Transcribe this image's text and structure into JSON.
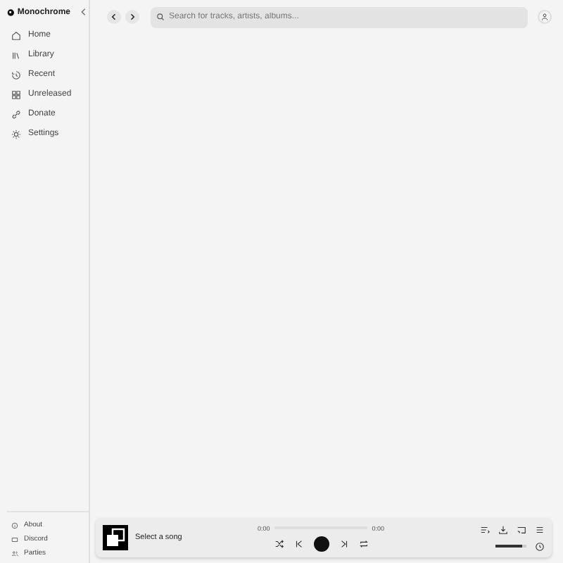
{
  "sidebar": {
    "brand": "Monochrome",
    "items": [
      {
        "label": "Home",
        "selected": false
      },
      {
        "label": "Library",
        "selected": false
      },
      {
        "label": "Recent",
        "selected": false
      },
      {
        "label": "Unreleased",
        "selected": false
      },
      {
        "label": "Donate",
        "selected": false
      },
      {
        "label": "Settings",
        "selected": false
      }
    ],
    "footer": [
      {
        "label": "About"
      },
      {
        "label": "Discord"
      },
      {
        "label": "Parties"
      }
    ]
  },
  "search": {
    "placeholder": "Search for tracks, artists, albums..."
  },
  "player": {
    "title": "Select a song",
    "elapsed": "0:00",
    "duration": "0:00",
    "volume": {
      "level": 0.85
    }
  }
}
